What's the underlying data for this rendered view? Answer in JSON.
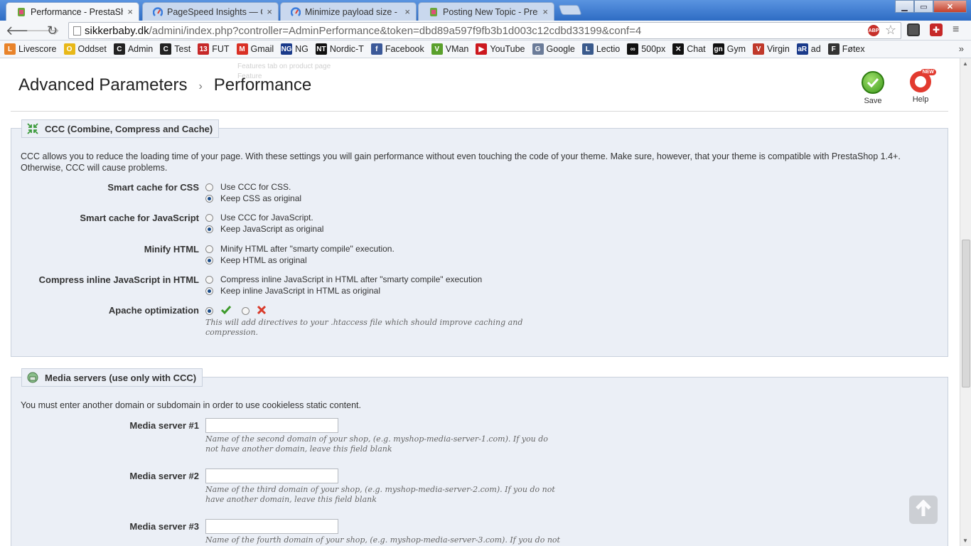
{
  "browser": {
    "tabs": [
      {
        "label": "Performance - PrestaShop",
        "close": "×",
        "active": true,
        "icon": "prestashop-icon"
      },
      {
        "label": "PageSpeed Insights — Goo",
        "close": "×",
        "active": false,
        "icon": "pagespeed-icon"
      },
      {
        "label": "Minimize payload size - M",
        "close": "×",
        "active": false,
        "icon": "pagespeed-icon"
      },
      {
        "label": "Posting New Topic - Prest",
        "close": "×",
        "active": false,
        "icon": "prestashop-icon"
      }
    ],
    "url_host": "sikkerbaby.dk",
    "url_path": "/admini/index.php?controller=AdminPerformance&token=dbd89a597f9fb3b1d003c12cdbd33199&conf=4",
    "abp_label": "ABP",
    "bookmarks": [
      {
        "label": "Livescore",
        "icon": "livescore-icon",
        "color": "#e8832a",
        "glyph": "L"
      },
      {
        "label": "Oddset",
        "icon": "oddset-icon",
        "color": "#e8b818",
        "glyph": "O"
      },
      {
        "label": "Admin",
        "icon": "c-icon",
        "color": "#222",
        "glyph": "C"
      },
      {
        "label": "Test",
        "icon": "c-icon",
        "color": "#222",
        "glyph": "C"
      },
      {
        "label": "FUT",
        "icon": "fut-icon",
        "color": "#c62828",
        "glyph": "13"
      },
      {
        "label": "Gmail",
        "icon": "gmail-icon",
        "color": "#d93025",
        "glyph": "M"
      },
      {
        "label": "NG",
        "icon": "ng-icon",
        "color": "#1a3a8a",
        "glyph": "NG"
      },
      {
        "label": "Nordic-T",
        "icon": "nt-icon",
        "color": "#111",
        "glyph": "NT"
      },
      {
        "label": "Facebook",
        "icon": "facebook-icon",
        "color": "#3b5998",
        "glyph": "f"
      },
      {
        "label": "VMan",
        "icon": "vman-icon",
        "color": "#5aa02c",
        "glyph": "V"
      },
      {
        "label": "YouTube",
        "icon": "youtube-icon",
        "color": "#cc181e",
        "glyph": "▶"
      },
      {
        "label": "Google",
        "icon": "google-icon",
        "color": "#6b7c99",
        "glyph": "G"
      },
      {
        "label": "Lectio",
        "icon": "lectio-icon",
        "color": "#3a5a8c",
        "glyph": "L"
      },
      {
        "label": "500px",
        "icon": "500px-icon",
        "color": "#111",
        "glyph": "∞"
      },
      {
        "label": "Chat",
        "icon": "chat-icon",
        "color": "#111",
        "glyph": "✕"
      },
      {
        "label": "Gym",
        "icon": "gym-icon",
        "color": "#111",
        "glyph": "gn"
      },
      {
        "label": "Virgin",
        "icon": "virgin-icon",
        "color": "#c0392b",
        "glyph": "V"
      },
      {
        "label": "ad",
        "icon": "ad-icon",
        "color": "#1a3a8a",
        "glyph": "aR"
      },
      {
        "label": "Føtex",
        "icon": "fotex-icon",
        "color": "#333",
        "glyph": "F"
      }
    ],
    "more_label": "»"
  },
  "page": {
    "ghost_lines": [
      "Features tab on product page",
      "Feature"
    ],
    "breadcrumb": {
      "parent": "Advanced Parameters",
      "separator": "›",
      "current": "Performance"
    },
    "save_label": "Save",
    "help_label": "Help",
    "help_badge": "NEW",
    "ccc": {
      "legend": "CCC (Combine, Compress and Cache)",
      "description": "CCC allows you to reduce the loading time of your page. With these settings you will gain performance without even touching the code of your theme. Make sure, however, that your theme is compatible with PrestaShop 1.4+. Otherwise, CCC will cause problems.",
      "rows": [
        {
          "label": "Smart cache for CSS",
          "options": [
            {
              "text": "Use CCC for CSS.",
              "checked": false
            },
            {
              "text": "Keep CSS as original",
              "checked": true
            }
          ]
        },
        {
          "label": "Smart cache for JavaScript",
          "options": [
            {
              "text": "Use CCC for JavaScript.",
              "checked": false
            },
            {
              "text": "Keep JavaScript as original",
              "checked": true
            }
          ]
        },
        {
          "label": "Minify HTML",
          "options": [
            {
              "text": "Minify HTML after \"smarty compile\" execution.",
              "checked": false
            },
            {
              "text": "Keep HTML as original",
              "checked": true
            }
          ]
        },
        {
          "label": "Compress inline JavaScript in HTML",
          "options": [
            {
              "text": "Compress inline JavaScript in HTML after \"smarty compile\" execution",
              "checked": false
            },
            {
              "text": "Keep inline JavaScript in HTML as original",
              "checked": true
            }
          ]
        }
      ],
      "apache": {
        "label": "Apache optimization",
        "yes_checked": true,
        "no_checked": false,
        "hint": "This will add directives to your .htaccess file which should improve caching and compression."
      }
    },
    "media": {
      "legend": "Media servers (use only with CCC)",
      "description": "You must enter another domain or subdomain in order to use cookieless static content.",
      "servers": [
        {
          "label": "Media server #1",
          "value": "",
          "hint": "Name of the second domain of your shop, (e.g. myshop-media-server-1.com). If you do not have another domain, leave this field blank"
        },
        {
          "label": "Media server #2",
          "value": "",
          "hint": "Name of the third domain of your shop, (e.g. myshop-media-server-2.com). If you do not have another domain, leave this field blank"
        },
        {
          "label": "Media server #3",
          "value": "",
          "hint": "Name of the fourth domain of your shop, (e.g. myshop-media-server-3.com). If you do not"
        }
      ]
    }
  }
}
